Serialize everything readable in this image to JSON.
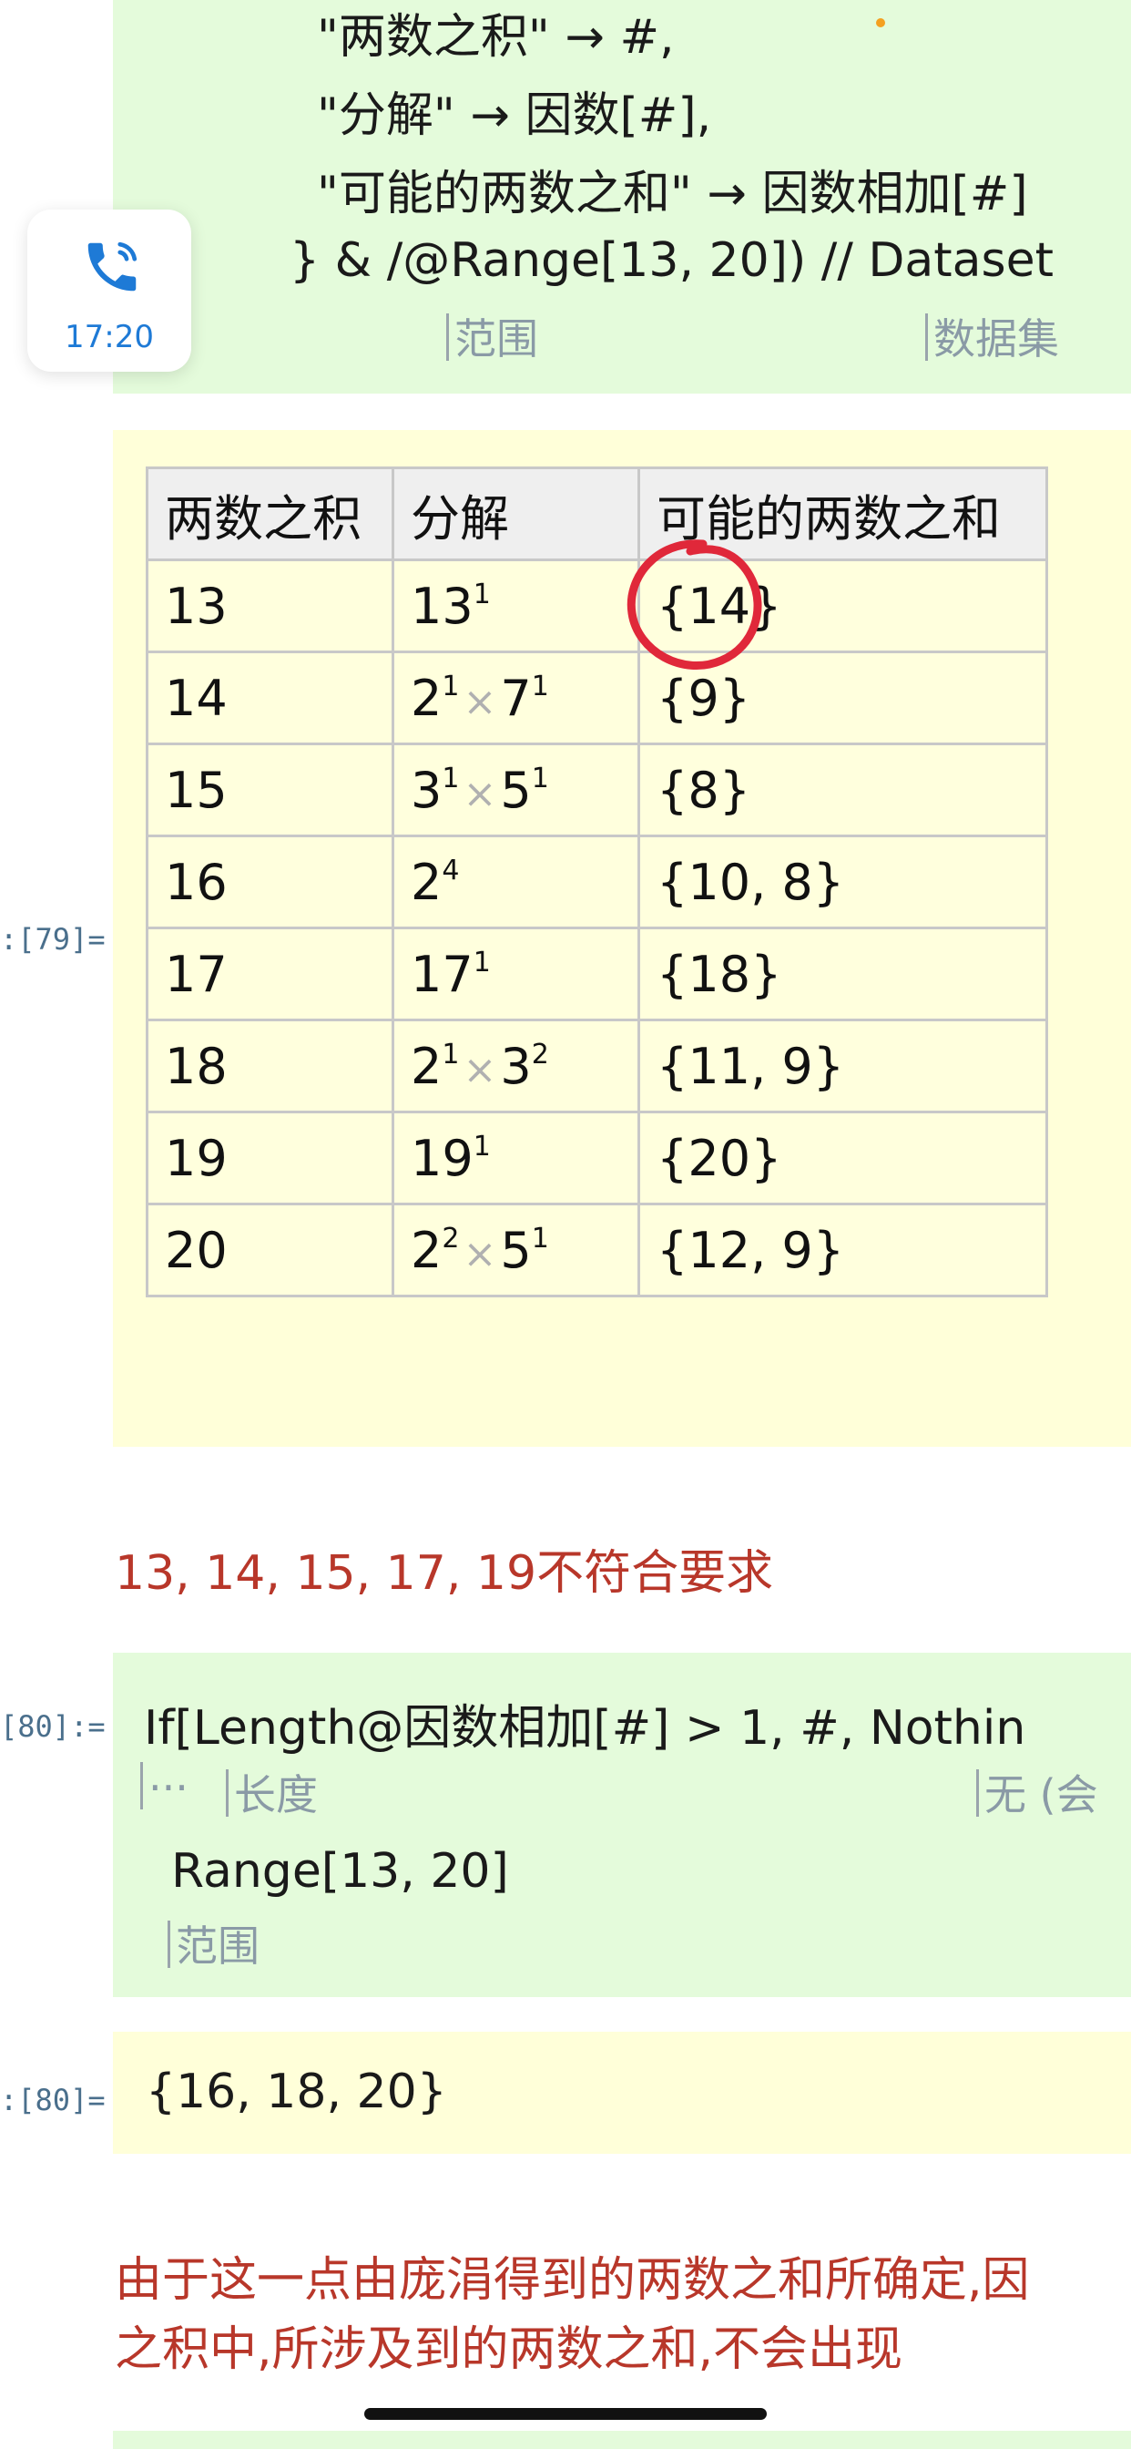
{
  "status": {
    "call_time": "17:20"
  },
  "cell1": {
    "line1": "\"两数之积\" → #,",
    "line2": "\"分解\" → 因数[#],",
    "line3": "\"可能的两数之和\" → 因数相加[#]",
    "line4": "} & /@Range[13, 20]) // Dataset",
    "hint_range": "范围",
    "hint_dataset": "数据集"
  },
  "out79": {
    "label": ":[79]=",
    "table": {
      "headers": [
        "两数之积",
        "分解",
        "可能的两数之和"
      ],
      "rows": [
        {
          "product": "13",
          "factorization": [
            [
              "13",
              "1"
            ]
          ],
          "sums": "{14}"
        },
        {
          "product": "14",
          "factorization": [
            [
              "2",
              "1"
            ],
            [
              "7",
              "1"
            ]
          ],
          "sums": "{9}"
        },
        {
          "product": "15",
          "factorization": [
            [
              "3",
              "1"
            ],
            [
              "5",
              "1"
            ]
          ],
          "sums": "{8}"
        },
        {
          "product": "16",
          "factorization": [
            [
              "2",
              "4"
            ]
          ],
          "sums": "{10, 8}"
        },
        {
          "product": "17",
          "factorization": [
            [
              "17",
              "1"
            ]
          ],
          "sums": "{18}"
        },
        {
          "product": "18",
          "factorization": [
            [
              "2",
              "1"
            ],
            [
              "3",
              "2"
            ]
          ],
          "sums": "{11, 9}"
        },
        {
          "product": "19",
          "factorization": [
            [
              "19",
              "1"
            ]
          ],
          "sums": "{20}"
        },
        {
          "product": "20",
          "factorization": [
            [
              "2",
              "2"
            ],
            [
              "5",
              "1"
            ]
          ],
          "sums": "{12, 9}"
        }
      ]
    }
  },
  "note1": "13, 14, 15, 17, 19不符合要求",
  "in80": {
    "label": "[80]:=",
    "line1": "If[Length@因数相加[#] > 1, #, Nothin",
    "hint_ellipsis": "···",
    "hint_length": "长度",
    "hint_nothing": "无 (会",
    "line2": "Range[13, 20]",
    "hint_range": "范围"
  },
  "out80": {
    "label": ":[80]=",
    "value": "{16, 18, 20}"
  },
  "note2": {
    "line1": "由于这一点由庞涓得到的两数之和所确定,因",
    "line2": "之积中,所涉及到的两数之和,不会出现"
  },
  "colors": {
    "input_bg": "#e4fbdb",
    "output_bg": "#ffffd9",
    "note_text": "#b8372a",
    "annotation_circle": "#e0283a",
    "call_blue": "#1e7ad6"
  }
}
